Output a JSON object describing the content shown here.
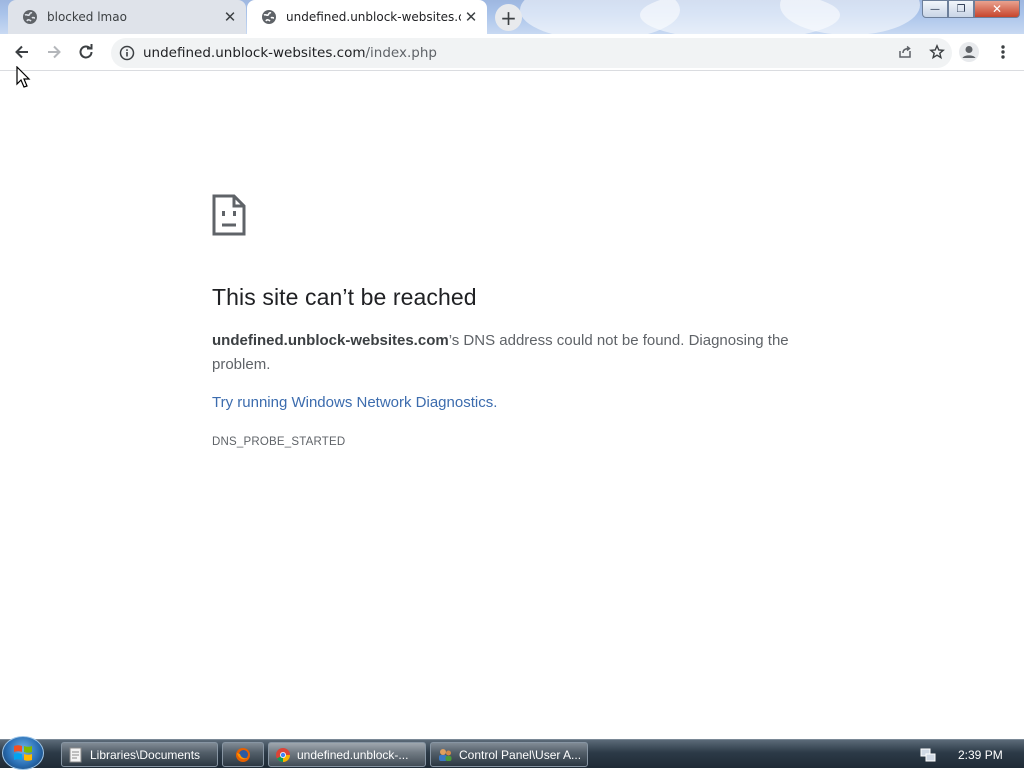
{
  "browser": {
    "tabs": [
      {
        "title": "blocked lmao",
        "active": false
      },
      {
        "title": "undefined.unblock-websites.com",
        "active": true
      }
    ],
    "new_tab_symbol": "+",
    "close_symbol": "✕",
    "window_controls": {
      "minimize": "—",
      "maximize": "❐",
      "close": "✕"
    },
    "toolbar": {
      "back_icon": "arrow-left-icon",
      "forward_icon": "arrow-right-icon",
      "reload_icon": "reload-icon",
      "url_host": "undefined.unblock-websites.com",
      "url_path": "/index.php",
      "share_icon": "share-icon",
      "bookmark_icon": "star-icon",
      "profile_icon": "profile-icon",
      "menu_icon": "kebab-menu-icon"
    }
  },
  "error_page": {
    "title": "This site can’t be reached",
    "host_bold": "undefined.unblock-websites.com",
    "message": "’s DNS address could not be found. Diagnosing the problem.",
    "link_text": "Try running Windows Network Diagnostics.",
    "error_code": "DNS_PROBE_STARTED"
  },
  "taskbar": {
    "items": [
      {
        "label": "Libraries\\Documents",
        "icon": "folder-icon"
      },
      {
        "label": "",
        "icon": "firefox-icon"
      },
      {
        "label": "undefined.unblock-...",
        "icon": "chrome-icon",
        "active": true
      },
      {
        "label": "Control Panel\\User A...",
        "icon": "control-panel-icon"
      }
    ],
    "clock": "2:39 PM"
  },
  "colors": {
    "link": "#3c6cae",
    "title_text": "#202124",
    "body_text": "#5f6368"
  }
}
